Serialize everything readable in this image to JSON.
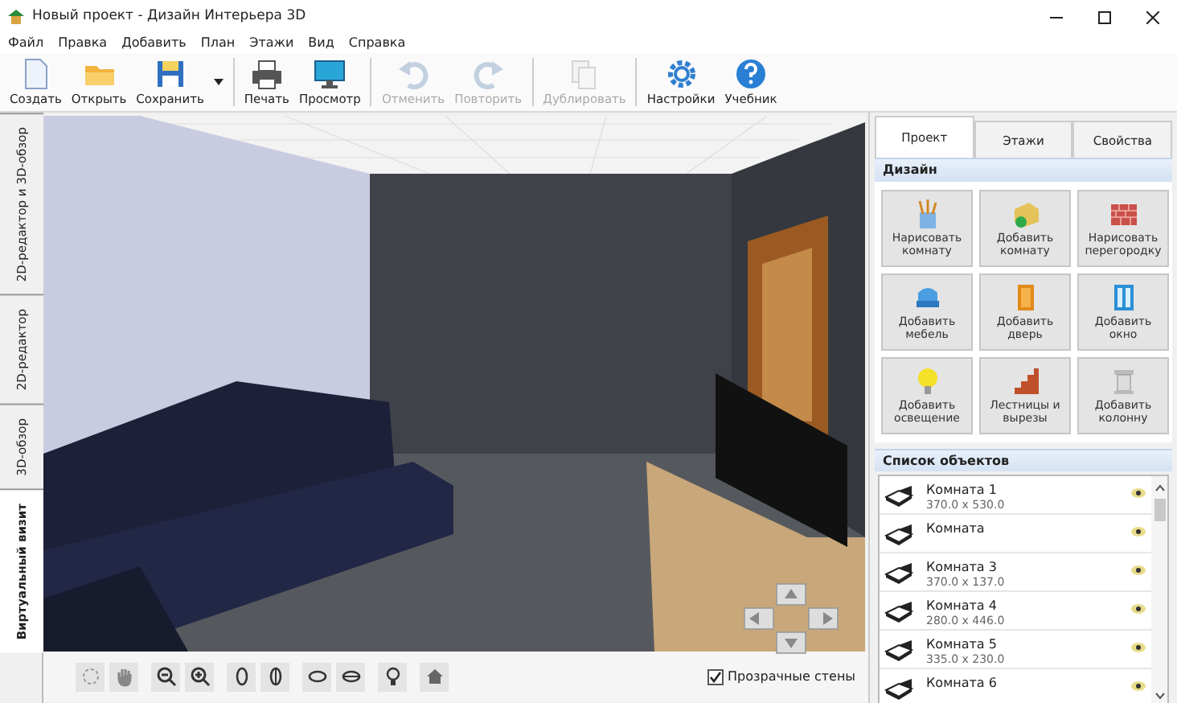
{
  "window": {
    "title": "Новый проект - Дизайн Интерьера 3D"
  },
  "menu": [
    "Файл",
    "Правка",
    "Добавить",
    "План",
    "Этажи",
    "Вид",
    "Справка"
  ],
  "toolbar_groups": [
    [
      {
        "label": "Создать",
        "disabled": false,
        "has_menu": false
      },
      {
        "label": "Открыть",
        "disabled": false,
        "has_menu": false
      },
      {
        "label": "Сохранить",
        "disabled": false,
        "has_menu": true
      }
    ],
    [
      {
        "label": "Печать",
        "disabled": false,
        "has_menu": false
      },
      {
        "label": "Просмотр",
        "disabled": false,
        "has_menu": false
      }
    ],
    [
      {
        "label": "Отменить",
        "disabled": true,
        "has_menu": false
      },
      {
        "label": "Повторить",
        "disabled": true,
        "has_menu": false
      }
    ],
    [
      {
        "label": "Дублировать",
        "disabled": true,
        "has_menu": false
      }
    ],
    [
      {
        "label": "Настройки",
        "disabled": false,
        "has_menu": false
      },
      {
        "label": "Учебник",
        "disabled": false,
        "has_menu": false
      }
    ]
  ],
  "view_tabs": [
    {
      "label": "2D-редактор и 3D-обзор",
      "selected": false
    },
    {
      "label": "2D-редактор",
      "selected": false
    },
    {
      "label": "3D-обзор",
      "selected": false
    },
    {
      "label": "Виртуальный визит",
      "selected": true
    }
  ],
  "transparent_walls": {
    "label": "Прозрачные стены",
    "checked": true
  },
  "panel": {
    "tabs": [
      {
        "label": "Проект",
        "selected": true
      },
      {
        "label": "Этажи",
        "selected": false
      },
      {
        "label": "Свойства",
        "selected": false
      }
    ],
    "design": {
      "title": "Дизайн",
      "tools": [
        "Нарисовать комнату",
        "Добавить комнату",
        "Нарисовать перегородку",
        "Добавить мебель",
        "Добавить дверь",
        "Добавить окно",
        "Добавить освещение",
        "Лестницы и вырезы",
        "Добавить колонну"
      ]
    },
    "objects": {
      "title": "Список объектов",
      "items": [
        {
          "name": "Комната 1",
          "size": "370.0 x 530.0"
        },
        {
          "name": "Комната"
        },
        {
          "name": "Комната 3",
          "size": "370.0 x 137.0"
        },
        {
          "name": "Комната 4",
          "size": "280.0 x 446.0"
        },
        {
          "name": "Комната 5",
          "size": "335.0 x 230.0"
        },
        {
          "name": "Комната 6"
        }
      ]
    }
  }
}
